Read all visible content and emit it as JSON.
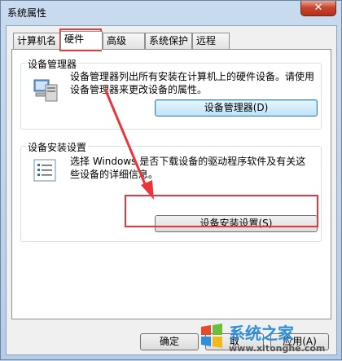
{
  "window": {
    "title": "系统属性",
    "close_label": "✕"
  },
  "tabs": [
    {
      "label": "计算机名",
      "active": false
    },
    {
      "label": "硬件",
      "active": true
    },
    {
      "label": "高级",
      "active": false
    },
    {
      "label": "系统保护",
      "active": false
    },
    {
      "label": "远程",
      "active": false
    }
  ],
  "device_manager": {
    "label": "设备管理器",
    "description": "设备管理器列出所有安装在计算机上的硬件设备。请使用设备管理器来更改设备的属性。",
    "button": "设备管理器(D)"
  },
  "device_install": {
    "label": "设备安装设置",
    "description": "选择 Windows 是否下载设备的驱动程序软件及有关这些设备的详细信息。",
    "button": "设备安装设置(S)"
  },
  "footer": {
    "ok_button": "确定",
    "cancel_partial": "取",
    "apply_partial": "应用(A)"
  },
  "watermark": {
    "brand": "系统之家",
    "url": "www.xitonghe.com"
  },
  "colors": {
    "annotation": "#e8363a",
    "accent": "#3c7fb1"
  }
}
